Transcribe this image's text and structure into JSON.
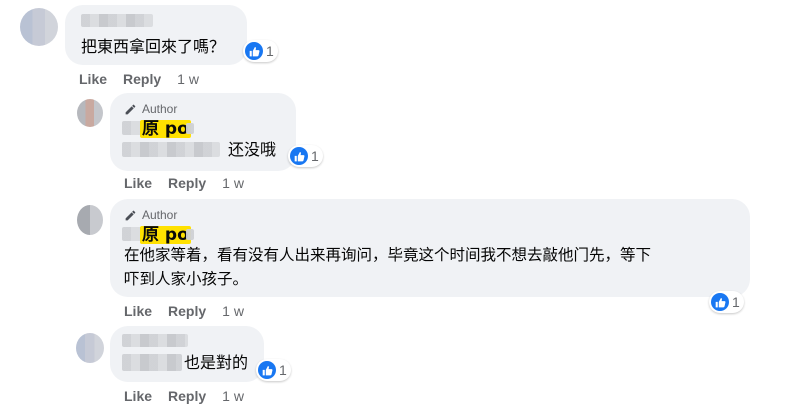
{
  "comments": [
    {
      "text": "把東西拿回來了嗎？",
      "reactions": "1",
      "actions": {
        "like": "Like",
        "reply": "Reply",
        "time": "1 w"
      }
    },
    {
      "author_badge": "Author",
      "tag": "原 po",
      "text": "还没哦",
      "reactions": "1",
      "actions": {
        "like": "Like",
        "reply": "Reply",
        "time": "1 w"
      }
    },
    {
      "author_badge": "Author",
      "tag": "原 po",
      "text_line1": "在他家等着，看有没有人出来再询问，毕竟这个时间我不想去敲他门先，等下",
      "text_line2": "吓到人家小孩子。",
      "reactions": "1",
      "actions": {
        "like": "Like",
        "reply": "Reply",
        "time": "1 w"
      }
    },
    {
      "text": "也是對的",
      "reactions": "1",
      "actions": {
        "like": "Like",
        "reply": "Reply",
        "time": "1 w"
      }
    }
  ],
  "colors": {
    "like_blue": "#1877f2",
    "bubble": "#f0f2f5",
    "meta_gray": "#65676b",
    "tag_yellow": "#ffe100"
  },
  "icons": {
    "reaction": "like-thumb-icon",
    "author": "pencil-icon"
  }
}
